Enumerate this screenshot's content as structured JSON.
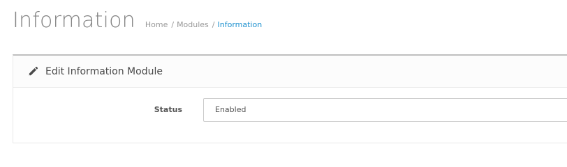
{
  "header": {
    "title": "Information",
    "breadcrumb": [
      {
        "label": "Home"
      },
      {
        "label": "Modules"
      },
      {
        "label": "Information",
        "active": true
      }
    ],
    "separator": "/"
  },
  "panel": {
    "heading": "Edit Information Module",
    "heading_icon": "pencil-icon",
    "status_label": "Status",
    "status_value": "Enabled"
  },
  "colors": {
    "title": "#848484",
    "breadcrumb": "#999999",
    "breadcrumb_active": "#1e91cf",
    "panel_top_border": "#bfbfbf"
  }
}
